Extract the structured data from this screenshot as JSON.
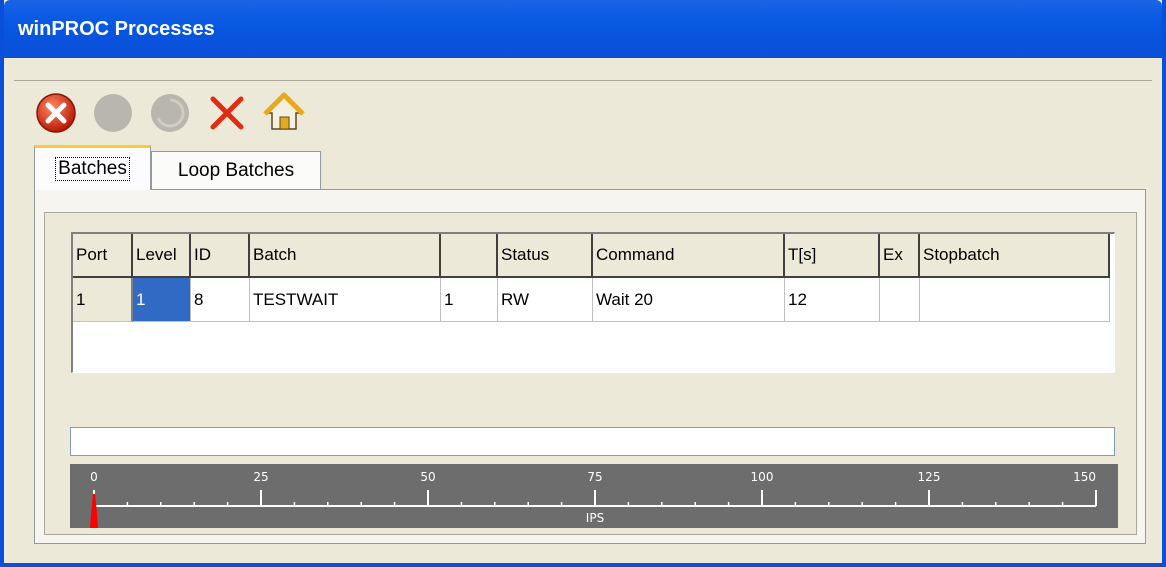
{
  "window": {
    "title": "winPROC Processes"
  },
  "toolbar": {
    "buttons": [
      {
        "icon": "stop-red-icon",
        "color": "#d03418"
      },
      {
        "icon": "gray-circle-icon",
        "color": "#b8b6ad"
      },
      {
        "icon": "gray-dial-icon",
        "color": "#b8b6ad"
      },
      {
        "icon": "red-x-icon",
        "color": "#e02c10"
      },
      {
        "icon": "home-icon",
        "color": "#f0c040"
      }
    ]
  },
  "tabs": [
    {
      "label": "Batches",
      "active": true
    },
    {
      "label": "Loop Batches",
      "active": false
    }
  ],
  "grid": {
    "columns": [
      "Port",
      "Level",
      "ID",
      "Batch",
      "",
      "Status",
      "Command",
      "T[s]",
      "Ex",
      "Stopbatch"
    ],
    "rows": [
      {
        "cells": [
          "1",
          "1",
          "8",
          "TESTWAIT",
          "1",
          "RW",
          "Wait 20",
          "12",
          "",
          ""
        ]
      }
    ],
    "selected_cell": "Level"
  },
  "gauge": {
    "unit": "IPS",
    "ticks": [
      "0",
      "25",
      "50",
      "75",
      "100",
      "125",
      "150"
    ],
    "value": 0,
    "max": 150,
    "indicator_color": "#ff0000"
  }
}
